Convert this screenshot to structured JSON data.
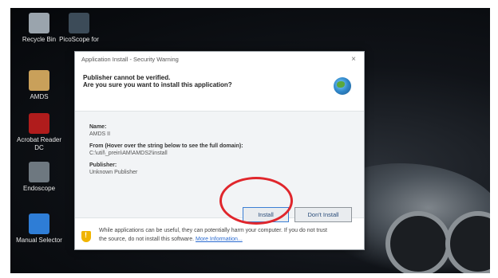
{
  "desktop": {
    "icons": [
      {
        "label": "Recycle Bin"
      },
      {
        "label": "PicoScope for"
      },
      {
        "label": "AMDS"
      },
      {
        "label": "Acrobat Reader DC"
      },
      {
        "label": "Endoscope"
      },
      {
        "label": "Manual Selector"
      }
    ]
  },
  "dialog": {
    "title": "Application Install - Security Warning",
    "close_glyph": "×",
    "warning_line1": "Publisher cannot be verified.",
    "warning_line2": "Are you sure you want to install this application?",
    "name_label": "Name:",
    "name_value": "AMDS II",
    "from_label": "From (Hover over the string below to see the full domain):",
    "from_value": "C:\\util\\_prein\\AM\\AMDS2\\install",
    "publisher_label": "Publisher:",
    "publisher_value": "Unknown Publisher",
    "install_button": "Install",
    "dont_install_button": "Don't Install",
    "footer_text_a": "While applications can be useful, they can potentially harm your computer. If you do not trust",
    "footer_text_b": "the source, do not install this software.",
    "more_info_link": "More Information..."
  },
  "colors": {
    "annotation_circle": "#e0262c",
    "link": "#2a6bd1"
  }
}
